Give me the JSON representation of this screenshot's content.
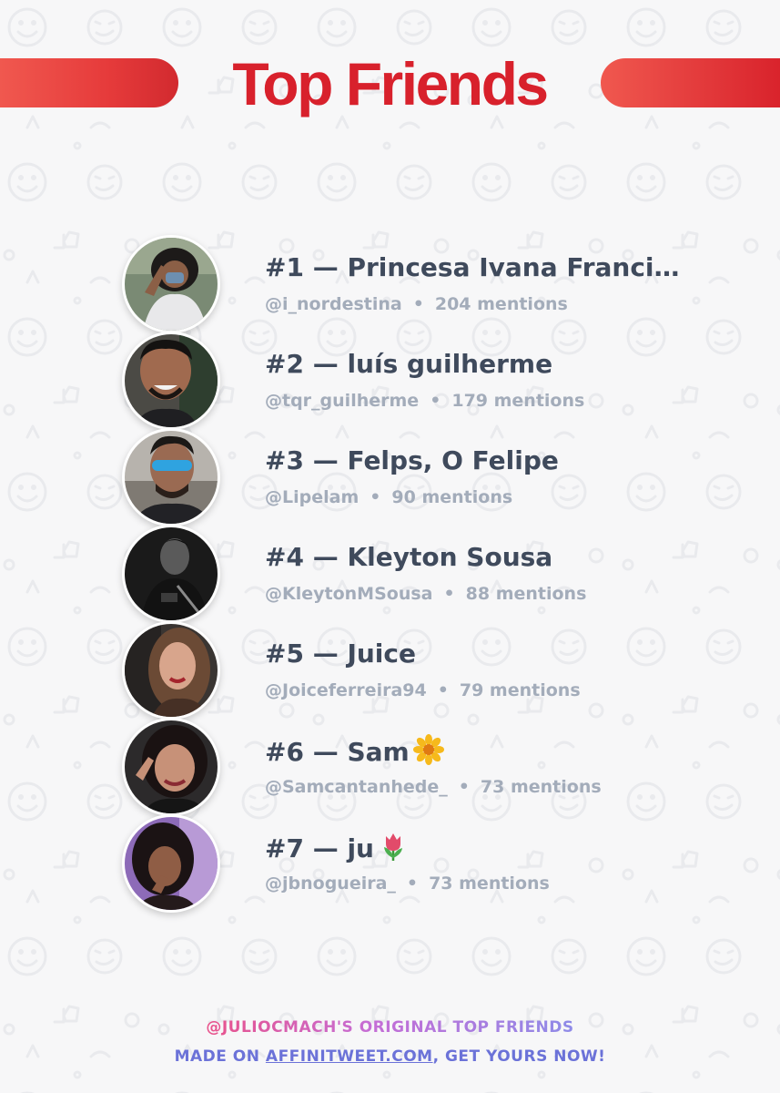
{
  "header": {
    "title": "Top Friends"
  },
  "friends": [
    {
      "rank": "#1",
      "name": "Princesa Ivana Franci…",
      "handle": "@i_nordestina",
      "mentions": "204 mentions",
      "emoji": ""
    },
    {
      "rank": "#2",
      "name": "luís guilherme",
      "handle": "@tqr_guilherme",
      "mentions": "179 mentions",
      "emoji": ""
    },
    {
      "rank": "#3",
      "name": "Felps, O Felipe",
      "handle": "@Lipelam",
      "mentions": "90 mentions",
      "emoji": ""
    },
    {
      "rank": "#4",
      "name": "Kleyton Sousa",
      "handle": "@KleytonMSousa",
      "mentions": "88 mentions",
      "emoji": ""
    },
    {
      "rank": "#5",
      "name": "Juice",
      "handle": "@Joiceferreira94",
      "mentions": "79 mentions",
      "emoji": ""
    },
    {
      "rank": "#6",
      "name": "Sam",
      "handle": "@Samcantanhede_",
      "mentions": "73 mentions",
      "emoji": "sunflower-icon"
    },
    {
      "rank": "#7",
      "name": "ju",
      "handle": "@jbnogueira_",
      "mentions": "73 mentions",
      "emoji": "tulip-icon"
    }
  ],
  "separator": "—",
  "bullet": "•",
  "footer": {
    "line1": "@JULIOCMACH'S ORIGINAL TOP FRIENDS",
    "line2_prefix": "MADE ON ",
    "line2_link": "AFFINITWEET.COM",
    "line2_suffix": ", GET YOURS NOW!"
  },
  "colors": {
    "title": "#d8212c",
    "accent_bar": "#e63b3b",
    "name_text": "#3f4a5c",
    "meta_text": "#a3acba",
    "footer_gradient_start": "#e9528a",
    "footer_gradient_end": "#8e8be8",
    "footer_link": "#6b72d8",
    "background": "#f7f7f8"
  }
}
